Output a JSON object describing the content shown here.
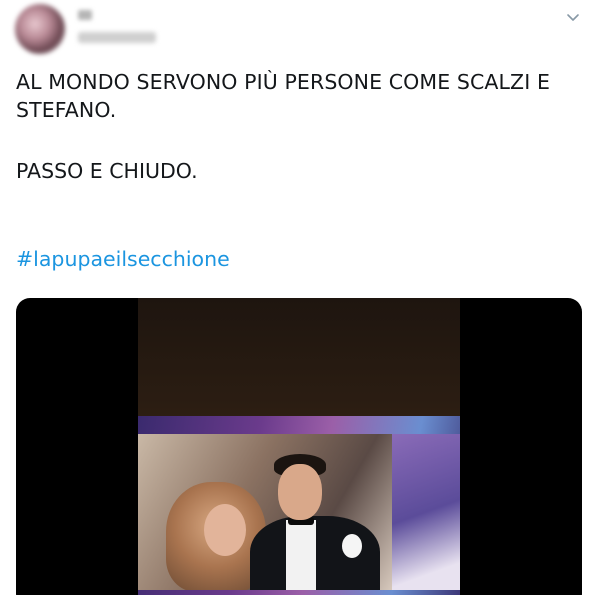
{
  "tweet": {
    "text_line1": "AL MONDO SERVONO PIÙ PERSONE COME SCALZI E\nSTEFANO.",
    "text_line2": "PASSO E CHIUDO.",
    "hashtag": "#lapupaeilsecchione"
  },
  "icons": {
    "menu": "chevron-down-icon"
  },
  "colors": {
    "text": "#14171a",
    "link": "#1b95e0",
    "media_bg": "#000000"
  }
}
